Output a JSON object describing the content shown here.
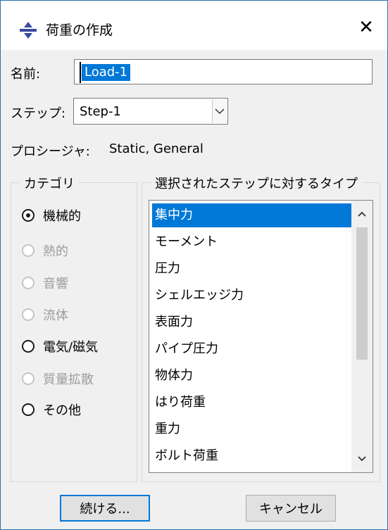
{
  "window": {
    "title": "荷重の作成",
    "close": "✕",
    "icons": {
      "app": "load-manager-icon",
      "close": "close-icon"
    }
  },
  "form": {
    "name_label": "名前:",
    "name_value": "Load-1",
    "step_label": "ステップ:",
    "step_value": "Step-1",
    "procedure_label": "プロシージャ:",
    "procedure_value": "Static, General"
  },
  "category": {
    "title": "カテゴリ",
    "options": [
      {
        "label": "機械的",
        "selected": true,
        "enabled": true
      },
      {
        "label": "熱的",
        "selected": false,
        "enabled": false
      },
      {
        "label": "音響",
        "selected": false,
        "enabled": false
      },
      {
        "label": "流体",
        "selected": false,
        "enabled": false
      },
      {
        "label": "電気/磁気",
        "selected": false,
        "enabled": true
      },
      {
        "label": "質量拡散",
        "selected": false,
        "enabled": false
      },
      {
        "label": "その他",
        "selected": false,
        "enabled": true
      }
    ]
  },
  "types": {
    "title": "選択されたステップに対するタイプ",
    "items": [
      "集中力",
      "モーメント",
      "圧力",
      "シェルエッジ力",
      "表面力",
      "パイプ圧力",
      "物体力",
      "はり荷重",
      "重力",
      "ボルト荷重"
    ],
    "selected_index": 0
  },
  "buttons": {
    "continue": "続ける...",
    "cancel": "キャンセル"
  },
  "colors": {
    "accent": "#0078d7",
    "disabled_text": "#9d9d9d",
    "border": "#2b6fb0"
  }
}
